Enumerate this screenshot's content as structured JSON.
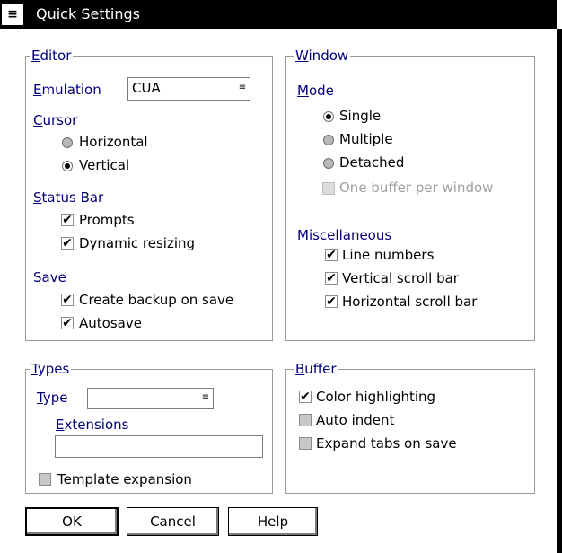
{
  "window": {
    "title": "Quick Settings",
    "system_menu_glyph": "≡"
  },
  "editor": {
    "group_title": "Editor",
    "emulation_label": "Emulation",
    "emulation_value": "CUA",
    "cursor": {
      "label": "Cursor",
      "options": [
        "Horizontal",
        "Vertical"
      ],
      "selected": "Vertical"
    },
    "status_bar": {
      "label": "Status Bar",
      "prompts": "Prompts",
      "dynamic_resizing": "Dynamic resizing"
    },
    "save": {
      "label": "Save",
      "create_backup": "Create backup on save",
      "autosave": "Autosave"
    }
  },
  "window_group": {
    "group_title": "Window",
    "mode": {
      "label": "Mode",
      "options": [
        "Single",
        "Multiple",
        "Detached"
      ],
      "selected": "Single",
      "one_buffer": "One buffer per window"
    },
    "misc": {
      "label": "Miscellaneous",
      "line_numbers": "Line numbers",
      "vertical_scroll": "Vertical scroll bar",
      "horizontal_scroll": "Horizontal scroll bar"
    }
  },
  "types": {
    "group_title": "Types",
    "type_label": "Type",
    "type_value": "",
    "extensions_label": "Extensions",
    "extensions_value": "",
    "template_expansion": "Template expansion"
  },
  "buffer": {
    "group_title": "Buffer",
    "color_highlighting": "Color highlighting",
    "auto_indent": "Auto indent",
    "expand_tabs": "Expand tabs on save"
  },
  "buttons": {
    "ok": "OK",
    "cancel": "Cancel",
    "help": "Help"
  },
  "check_glyph": "✔",
  "combo_glyph": "≡",
  "colors": {
    "section_label": "#00007b",
    "title_bar": "#000000",
    "disabled": "#a0a0a0"
  }
}
